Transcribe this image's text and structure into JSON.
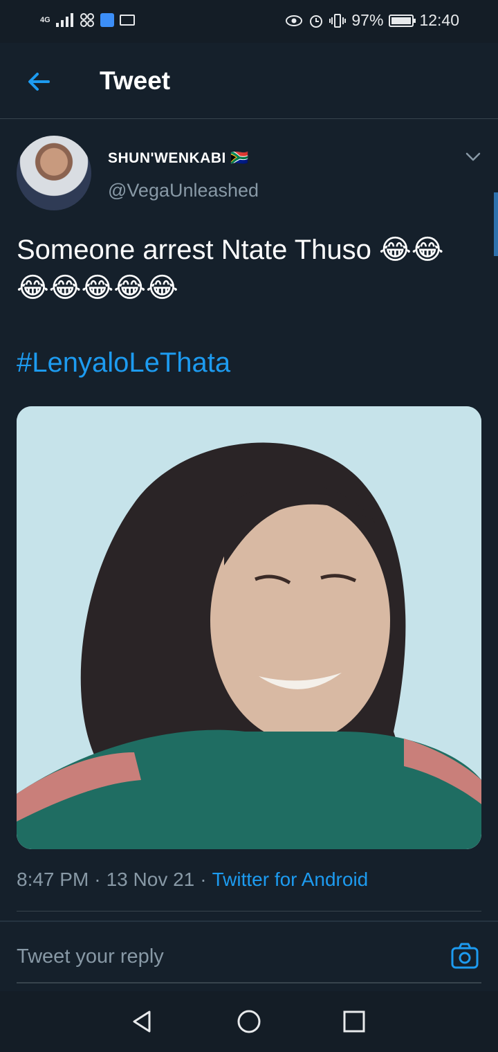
{
  "status_bar": {
    "network": "4G",
    "battery_percent": "97%",
    "time": "12:40",
    "icons": [
      "signal-icon",
      "connection-icon",
      "shield-icon",
      "mail-icon",
      "eye-icon",
      "alarm-icon",
      "vibrate-icon",
      "battery-icon"
    ]
  },
  "header": {
    "title": "Tweet",
    "back_icon": "arrow-left-icon"
  },
  "tweet": {
    "author_name": "SHUN'WENKABI 🇿🇦",
    "handle": "@VegaUnleashed",
    "text": "Someone arrest Ntate Thuso 😂😂😂😂😂😂😂",
    "hashtag": "#LenyaloLeThata",
    "time": "8:47 PM",
    "date": "13 Nov 21",
    "source": "Twitter for Android",
    "separator": "·"
  },
  "reply": {
    "placeholder": "Tweet your reply",
    "camera_icon": "camera-icon"
  },
  "nav": {
    "icons": [
      "back-nav-icon",
      "home-nav-icon",
      "recents-nav-icon"
    ]
  },
  "colors": {
    "background": "#15202b",
    "accent": "#1d9bf0",
    "muted": "#8899a6",
    "divider": "#38444d"
  }
}
